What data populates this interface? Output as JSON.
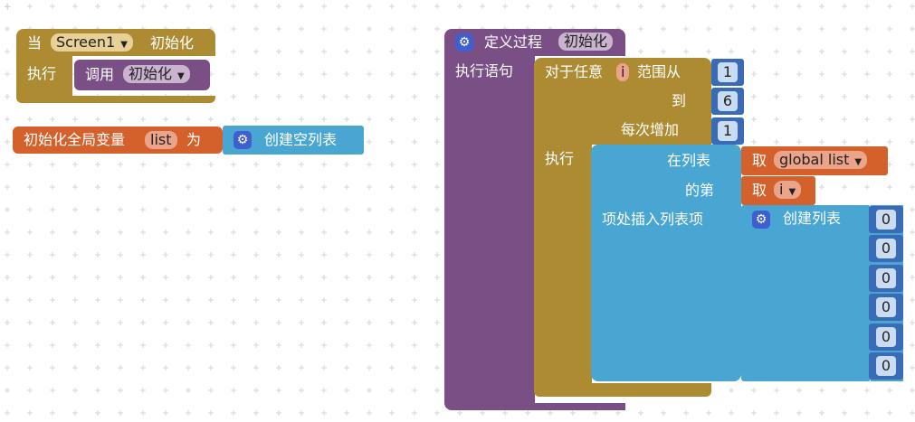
{
  "colors": {
    "event": "#ad8b32",
    "procedure": "#7a4f86",
    "variable": "#d4612b",
    "list": "#49a5d2",
    "math": "#3a6bb6",
    "control": "#b08b37"
  },
  "event_block": {
    "when": "当",
    "component": "Screen1",
    "event": "初始化",
    "do": "执行",
    "call": "调用",
    "call_target": "初始化"
  },
  "global_block": {
    "init": "初始化全局变量",
    "var_name": "list",
    "as": "为",
    "value": "创建空列表"
  },
  "procedure_block": {
    "define": "定义过程",
    "name": "初始化",
    "body_label": "执行语句",
    "for_each": "对于任意",
    "loop_var": "i",
    "from": "范围从",
    "from_val": "1",
    "to": "到",
    "to_val": "6",
    "by": "每次增加",
    "by_val": "1",
    "do": "执行",
    "insert": {
      "in_list": "在列表",
      "get1": "取",
      "list_ref": "global list",
      "index": "的第",
      "get2": "取",
      "index_ref": "i",
      "item": "项处插入列表项",
      "make_list": "创建列表",
      "items": [
        "0",
        "0",
        "0",
        "0",
        "0",
        "0"
      ]
    }
  }
}
